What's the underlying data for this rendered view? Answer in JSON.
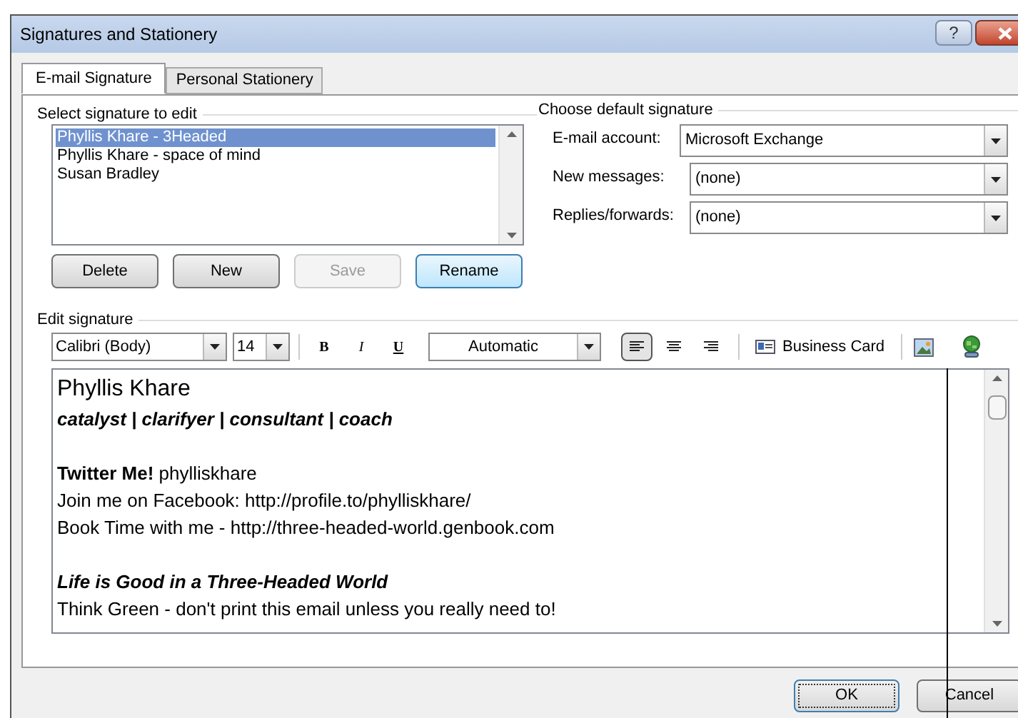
{
  "window": {
    "title": "Signatures and Stationery",
    "help": "?"
  },
  "tabs": [
    {
      "label": "E-mail Signature",
      "selected": true
    },
    {
      "label": "Personal Stationery",
      "selected": false
    }
  ],
  "select_signature": {
    "label": "Select signature to edit",
    "items": [
      {
        "label": "Phyllis Khare - 3Headed",
        "selected": true
      },
      {
        "label": "Phyllis Khare - space of mind",
        "selected": false
      },
      {
        "label": "Susan Bradley",
        "selected": false
      }
    ],
    "buttons": [
      {
        "label": "Delete",
        "disabled": false,
        "highlighted": false
      },
      {
        "label": "New",
        "disabled": false,
        "highlighted": false
      },
      {
        "label": "Save",
        "disabled": true,
        "highlighted": false
      },
      {
        "label": "Rename",
        "disabled": false,
        "highlighted": true
      }
    ]
  },
  "default_signature": {
    "label": "Choose default signature",
    "fields": [
      {
        "label": "E-mail account:",
        "value": "Microsoft Exchange"
      },
      {
        "label": "New messages:",
        "value": "(none)"
      },
      {
        "label": "Replies/forwards:",
        "value": "(none)"
      }
    ]
  },
  "edit_signature": {
    "label": "Edit signature",
    "font": "Calibri (Body)",
    "size": "14",
    "format_buttons": [
      "B",
      "I",
      "U"
    ],
    "font_color_field": "Automatic",
    "align_buttons": [
      {
        "kind": "left",
        "selected": true
      },
      {
        "kind": "center",
        "selected": false
      },
      {
        "kind": "right",
        "selected": false
      }
    ],
    "business_card": "Business Card",
    "lines": [
      {
        "kind": "name",
        "text": "Phyllis Khare"
      },
      {
        "kind": "tagline",
        "text": "catalyst | clarifyer | consultant | coach"
      },
      {
        "kind": "blank"
      },
      {
        "kind": "text",
        "text": "**Twitter Me!** phylliskhare"
      },
      {
        "kind": "text",
        "text": "Join me on Facebook: http://profile.to/phylliskhare/"
      },
      {
        "kind": "text",
        "text": "Book Time with me - http://three-headed-world.genbook.com"
      },
      {
        "kind": "blank"
      },
      {
        "kind": "tagline",
        "text": "Life is Good in a Three-Headed World"
      },
      {
        "kind": "text",
        "text": "Think Green - don't print this email unless you really need to!"
      }
    ]
  },
  "buttons": [
    {
      "label": "OK",
      "default": true
    },
    {
      "label": "Cancel",
      "default": false
    }
  ]
}
